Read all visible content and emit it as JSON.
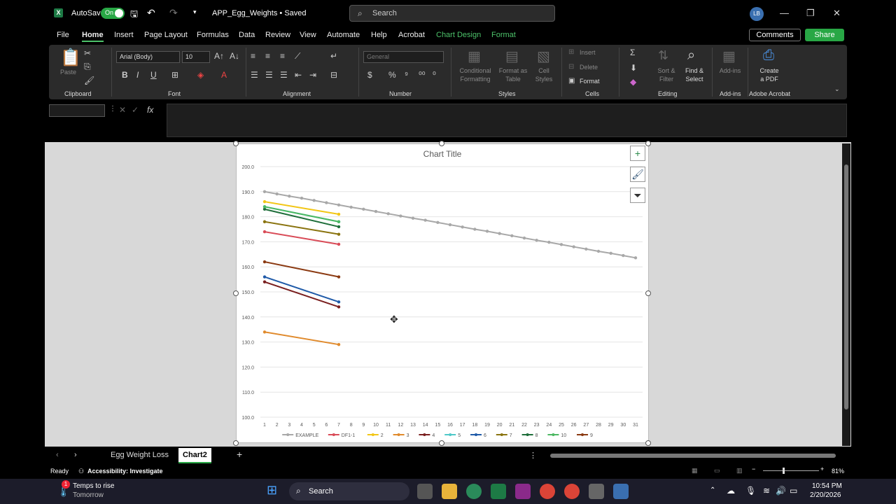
{
  "titlebar": {
    "autosave_label": "AutoSave",
    "toggle_state": "On",
    "doc_title": "APP_Egg_Weights • Saved",
    "search_placeholder": "Search",
    "user_initials": "LB"
  },
  "menu": {
    "items": [
      "File",
      "Home",
      "Insert",
      "Page Layout",
      "Formulas",
      "Data",
      "Review",
      "View",
      "Automate",
      "Help",
      "Acrobat",
      "Chart Design",
      "Format"
    ],
    "active": "Home",
    "comments": "Comments",
    "share": "Share"
  },
  "ribbon": {
    "font_name": "Arial (Body)",
    "font_size": "10",
    "number_format": "General",
    "groups": {
      "clipboard": "Clipboard",
      "font": "Font",
      "alignment": "Alignment",
      "number": "Number",
      "styles": "Styles",
      "cells": "Cells",
      "editing": "Editing",
      "addins": "Add-ins",
      "acrobat": "Adobe Acrobat"
    },
    "buttons": {
      "paste": "Paste",
      "cond_fmt_1": "Conditional",
      "cond_fmt_2": "Formatting",
      "fmt_table_1": "Format as",
      "fmt_table_2": "Table",
      "cell_styles_1": "Cell",
      "cell_styles_2": "Styles",
      "insert": "Insert",
      "delete": "Delete",
      "format": "Format",
      "sort_1": "Sort &",
      "sort_2": "Filter",
      "find_1": "Find &",
      "find_2": "Select",
      "addins": "Add-ins",
      "pdf_1": "Create",
      "pdf_2": "a PDF"
    }
  },
  "chart_data": {
    "type": "line",
    "title": "Chart Title",
    "ylim": [
      100,
      200
    ],
    "ytick_step": 10,
    "categories": [
      1,
      2,
      3,
      4,
      5,
      6,
      7,
      8,
      9,
      10,
      11,
      12,
      13,
      14,
      15,
      16,
      17,
      18,
      19,
      20,
      21,
      22,
      23,
      24,
      25,
      26,
      27,
      28,
      29,
      30,
      31
    ],
    "legend_position": "bottom",
    "grid": true,
    "series": [
      {
        "name": "EXAMPLE",
        "color": "#a8a8a8",
        "values": [
          190.0,
          189.1,
          188.2,
          187.4,
          186.5,
          185.6,
          184.7,
          183.8,
          183.0,
          182.1,
          181.2,
          180.3,
          179.4,
          178.6,
          177.7,
          176.8,
          175.9,
          175.0,
          174.2,
          173.3,
          172.4,
          171.5,
          170.6,
          169.8,
          168.9,
          168.0,
          167.1,
          166.2,
          165.4,
          164.5,
          163.6
        ]
      },
      {
        "name": "DF1-1",
        "color": "#d94b57",
        "values": [
          174,
          null,
          null,
          null,
          null,
          null,
          169
        ]
      },
      {
        "name": "2",
        "color": "#f2c616",
        "values": [
          186,
          null,
          null,
          null,
          null,
          null,
          181
        ]
      },
      {
        "name": "3",
        "color": "#e08a2c",
        "values": [
          134,
          null,
          null,
          null,
          null,
          null,
          129
        ]
      },
      {
        "name": "4",
        "color": "#7a1f1f",
        "values": [
          154,
          null,
          null,
          null,
          null,
          null,
          144
        ]
      },
      {
        "name": "5",
        "color": "#4fc8c8",
        "values": [
          184,
          null,
          null,
          null,
          null,
          null,
          178
        ]
      },
      {
        "name": "6",
        "color": "#1f5aa8",
        "values": [
          156,
          null,
          null,
          null,
          null,
          null,
          146
        ]
      },
      {
        "name": "7",
        "color": "#8a7410",
        "values": [
          178,
          null,
          null,
          null,
          null,
          null,
          173
        ]
      },
      {
        "name": "8",
        "color": "#1e6e3a",
        "values": [
          183,
          null,
          null,
          null,
          null,
          null,
          176
        ]
      },
      {
        "name": "10",
        "color": "#4cb862",
        "values": [
          184,
          null,
          null,
          null,
          null,
          null,
          178
        ]
      },
      {
        "name": "9",
        "color": "#8b3a12",
        "values": [
          162,
          null,
          null,
          null,
          null,
          null,
          156
        ]
      }
    ]
  },
  "sheets": {
    "tabs": [
      "Egg Weight Loss",
      "Chart2"
    ],
    "active": "Chart2"
  },
  "status": {
    "ready": "Ready",
    "accessibility": "Accessibility: Investigate",
    "zoom": "81%"
  },
  "taskbar": {
    "weather_line1": "Temps to rise",
    "weather_line2": "Tomorrow",
    "badge": "1",
    "search": "Search",
    "time": "10:54 PM",
    "date": "2/20/2026"
  }
}
